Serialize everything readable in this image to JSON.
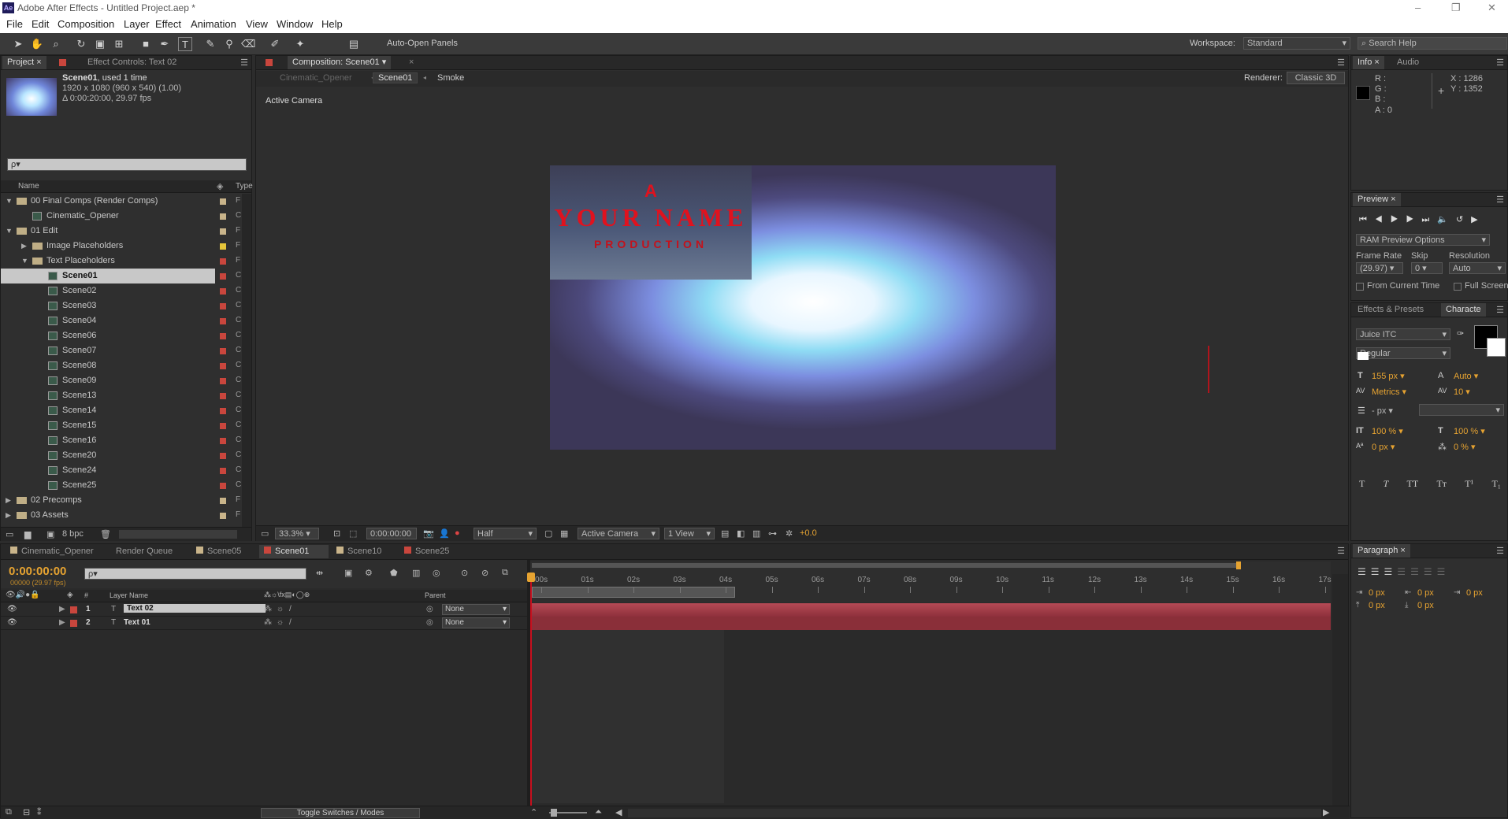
{
  "app": {
    "title": "Adobe After Effects - Untitled Project.aep *",
    "logo": "Ae"
  },
  "window_controls": [
    "–",
    "❐",
    "✕"
  ],
  "menu": [
    "File",
    "Edit",
    "Composition",
    "Layer",
    "Effect",
    "Animation",
    "View",
    "Window",
    "Help"
  ],
  "toolbar": {
    "auto_open": "Auto-Open Panels",
    "workspace_label": "Workspace:",
    "workspace_value": "Standard",
    "search_placeholder": "Search Help"
  },
  "project": {
    "tab": "Project",
    "effect_tab": "Effect Controls: Text 02",
    "comp_name": "Scene01",
    "used": ", used 1 time",
    "res": "1920 x 1080  (960 x 540) (1.00)",
    "dur": "Δ 0:00:20:00, 29.97 fps",
    "search_placeholder": "ρ▾",
    "col_name": "Name",
    "col_type": "Type",
    "bpc": "8 bpc",
    "items": [
      {
        "label": "00 Final Comps (Render Comps)",
        "kind": "folder",
        "depth": 0,
        "color": "#c9b48a",
        "open": true
      },
      {
        "label": "Cinematic_Opener",
        "kind": "comp",
        "depth": 1,
        "color": "#c9b48a"
      },
      {
        "label": "01 Edit",
        "kind": "folder",
        "depth": 0,
        "color": "#c9b48a",
        "open": true
      },
      {
        "label": "Image Placeholders",
        "kind": "folder",
        "depth": 1,
        "color": "#e5c53a",
        "open": false
      },
      {
        "label": "Text Placeholders",
        "kind": "folder",
        "depth": 1,
        "color": "#c9463d",
        "open": true
      },
      {
        "label": "Scene01",
        "kind": "comp",
        "depth": 2,
        "color": "#c9463d",
        "selected": true
      },
      {
        "label": "Scene02",
        "kind": "comp",
        "depth": 2,
        "color": "#c9463d"
      },
      {
        "label": "Scene03",
        "kind": "comp",
        "depth": 2,
        "color": "#c9463d"
      },
      {
        "label": "Scene04",
        "kind": "comp",
        "depth": 2,
        "color": "#c9463d"
      },
      {
        "label": "Scene06",
        "kind": "comp",
        "depth": 2,
        "color": "#c9463d"
      },
      {
        "label": "Scene07",
        "kind": "comp",
        "depth": 2,
        "color": "#c9463d"
      },
      {
        "label": "Scene08",
        "kind": "comp",
        "depth": 2,
        "color": "#c9463d"
      },
      {
        "label": "Scene09",
        "kind": "comp",
        "depth": 2,
        "color": "#c9463d"
      },
      {
        "label": "Scene13",
        "kind": "comp",
        "depth": 2,
        "color": "#c9463d"
      },
      {
        "label": "Scene14",
        "kind": "comp",
        "depth": 2,
        "color": "#c9463d"
      },
      {
        "label": "Scene15",
        "kind": "comp",
        "depth": 2,
        "color": "#c9463d"
      },
      {
        "label": "Scene16",
        "kind": "comp",
        "depth": 2,
        "color": "#c9463d"
      },
      {
        "label": "Scene20",
        "kind": "comp",
        "depth": 2,
        "color": "#c9463d"
      },
      {
        "label": "Scene24",
        "kind": "comp",
        "depth": 2,
        "color": "#c9463d"
      },
      {
        "label": "Scene25",
        "kind": "comp",
        "depth": 2,
        "color": "#c9463d"
      },
      {
        "label": "02 Precomps",
        "kind": "folder",
        "depth": 0,
        "color": "#c9b48a",
        "open": false
      },
      {
        "label": "03 Assets",
        "kind": "folder",
        "depth": 0,
        "color": "#c9b48a",
        "open": false
      }
    ]
  },
  "composition": {
    "tab": "Composition: Scene01",
    "crumbs": [
      "Cinematic_Opener",
      "Scene01",
      "Smoke"
    ],
    "renderer_label": "Renderer:",
    "renderer_value": "Classic 3D",
    "active_camera": "Active Camera",
    "title_a": "A",
    "title_name": "YOUR NAME",
    "title_prod": "PRODUCTION",
    "zoom": "33.3%",
    "timecode": "0:00:00:00",
    "resolution": "Half",
    "view": "Active Camera",
    "views": "1 View",
    "exposure": "+0.0"
  },
  "info": {
    "tab": "Info",
    "audio_tab": "Audio",
    "r": "R :",
    "g": "G :",
    "b": "B :",
    "a": "A : 0",
    "x": "X : 1286",
    "y": "Y : 1352"
  },
  "preview": {
    "tab": "Preview",
    "ram": "RAM Preview Options",
    "frame_rate_label": "Frame Rate",
    "skip_label": "Skip",
    "resolution_label": "Resolution",
    "fps": "(29.97)",
    "skip": "0",
    "res": "Auto",
    "from_current": "From Current Time",
    "full_screen": "Full Screen"
  },
  "character": {
    "effects_tab": "Effects & Presets",
    "char_tab": "Characte",
    "font": "Juice ITC",
    "style": "Regular",
    "size": "155 px",
    "leading": "Auto",
    "kerning": "Metrics",
    "tracking": "10",
    "stroke": "- px",
    "vscale": "100 %",
    "hscale": "100 %",
    "baseline": "0 px",
    "tsume": "0 %",
    "styles": [
      "T",
      "T",
      "TT",
      "Tт",
      "T¹",
      "T₁"
    ]
  },
  "paragraph": {
    "tab": "Paragraph",
    "indent1": "0 px",
    "indent2": "0 px",
    "indent3": "0 px",
    "space1": "0 px",
    "space2": "0 px"
  },
  "timeline": {
    "tabs": [
      "Cinematic_Opener",
      "Render Queue",
      "Scene05",
      "Scene01",
      "Scene10",
      "Scene25"
    ],
    "tab_colors": [
      "#c9b48a",
      "",
      "#c9b48a",
      "#c9463d",
      "#c9b48a",
      "#c9463d"
    ],
    "timecode": "0:00:00:00",
    "frames": "00000 (29.97 fps)",
    "search_placeholder": "ρ▾",
    "col_num": "#",
    "col_layer": "Layer Name",
    "col_parent": "Parent",
    "layers": [
      {
        "num": "1",
        "name": "Text 02",
        "parent": "None",
        "selected": true
      },
      {
        "num": "2",
        "name": "Text 01",
        "parent": "None",
        "selected": false
      }
    ],
    "ticks": [
      "00s",
      "01s",
      "02s",
      "03s",
      "04s",
      "05s",
      "06s",
      "07s",
      "08s",
      "09s",
      "10s",
      "11s",
      "12s",
      "13s",
      "14s",
      "15s",
      "16s",
      "17s"
    ],
    "toggle": "Toggle Switches / Modes"
  }
}
